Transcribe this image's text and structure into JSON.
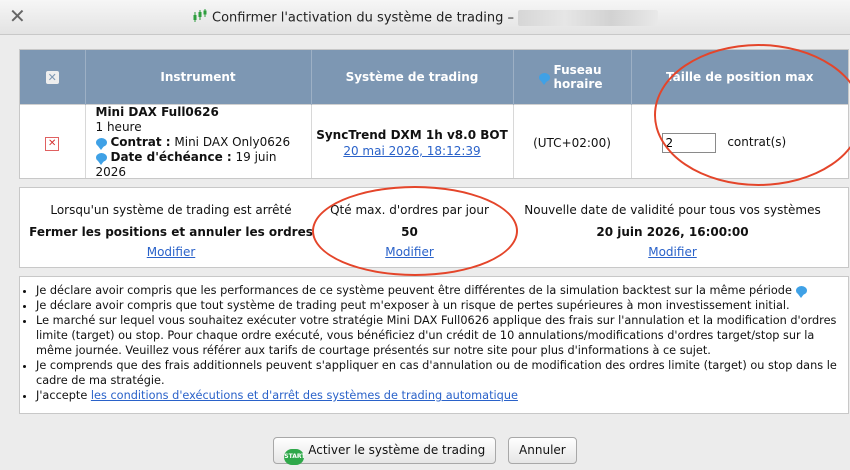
{
  "window": {
    "close_glyph": "✕",
    "title": "Confirmer l'activation du système de trading –",
    "title_icon": "candlestick-chart-icon"
  },
  "table": {
    "headers": {
      "checkbox_glyph": "✕",
      "instrument": "Instrument",
      "system": "Système de trading",
      "timezone": "Fuseau horaire",
      "max_position": "Taille de position max"
    },
    "row": {
      "checkbox_glyph": "✕",
      "instrument_name": "Mini DAX Full0626",
      "period": "1 heure",
      "contract_label": "Contrat :",
      "contract_value": "Mini DAX Only0626",
      "expiry_label": "Date d'échéance :",
      "expiry_value": "19 juin 2026",
      "system_name": "SyncTrend DXM 1h v8.0 BOT",
      "system_date": "20 mai 2026, 18:12:39",
      "timezone": "(UTC+02:00)",
      "max_position_value": "2",
      "max_position_unit": "contrat(s)"
    }
  },
  "settings": [
    {
      "title": "Lorsqu'un système de trading est arrêté",
      "value": "Fermer les positions et annuler les ordres",
      "action": "Modifier"
    },
    {
      "title": "Qté max. d'ordres par jour",
      "value": "50",
      "action": "Modifier"
    },
    {
      "title": "Nouvelle date de validité pour tous vos systèmes",
      "value": "20 juin 2026, 16:00:00",
      "action": "Modifier"
    }
  ],
  "notes": {
    "items": [
      "Je déclare avoir compris que les performances de ce système peuvent être différentes de la simulation backtest sur la même période",
      "Je déclare avoir compris que tout système de trading peut m'exposer à un risque de pertes supérieures à mon investissement initial.",
      "Le marché sur lequel vous souhaitez exécuter votre stratégie Mini DAX Full0626 applique des frais sur l'annulation et la modification d'ordres limite (target) ou stop. Pour chaque ordre exécuté, vous bénéficiez d'un crédit de 10 annulations/modifications d'ordres target/stop sur la même journée. Veuillez vous référer aux tarifs de courtage présentés sur notre site pour plus d'informations à ce sujet.",
      "Je comprends que des frais additionnels peuvent s'appliquer en cas d'annulation ou de modification des ordres limite (target) ou stop dans le cadre de ma stratégie."
    ],
    "accept_prefix": "J'accepte ",
    "accept_link": "les conditions d'exécutions et d'arrêt des systèmes de trading automatique"
  },
  "buttons": {
    "start_icon_text": "START",
    "activate": "Activer le système de trading",
    "cancel": "Annuler"
  },
  "colors": {
    "header_bg": "#7d97b3",
    "link": "#2a62c9",
    "annotation_circle": "#e4452a",
    "info_bubble": "#3fa1e6",
    "start_green": "#2fa84a"
  }
}
